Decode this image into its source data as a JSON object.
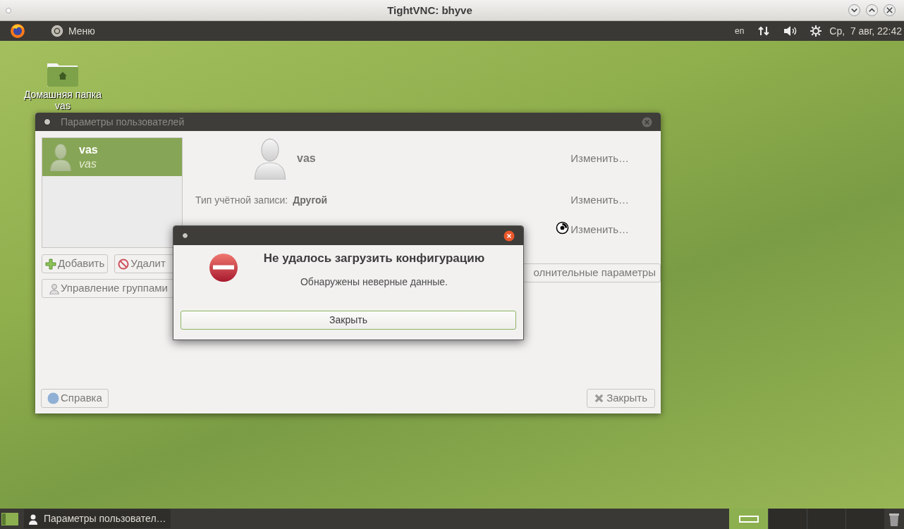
{
  "window": {
    "title": "TightVNC: bhyve"
  },
  "top_panel": {
    "menu_label": "Меню",
    "keyboard_layout": "en",
    "clock": "Ср,  7 авг, 22:42"
  },
  "desktop_icons": [
    {
      "label": "Домашняя папка vas"
    }
  ],
  "users_window": {
    "title": "Параметры пользователей",
    "users": [
      {
        "name": "vas",
        "login": "vas",
        "selected": true
      }
    ],
    "user_name": "vas",
    "rows": [
      {
        "label": "",
        "value": "",
        "action": "Изменить…"
      },
      {
        "label": "Тип учётной записи:",
        "value": "Другой",
        "action": "Изменить…"
      },
      {
        "label": "",
        "value": "",
        "action": "Изменить…"
      }
    ],
    "add_button": "Добавить",
    "remove_button": "Удалит",
    "groups_button": "Управление группами",
    "advanced_button": "олнительные параметры",
    "help_button": "Справка",
    "close_button": "Закрыть"
  },
  "error_dialog": {
    "heading": "Не удалось загрузить конфигурацию",
    "message": "Обнаружены неверные данные.",
    "button": "Закрыть"
  },
  "taskbar": {
    "tasks": [
      {
        "label": "Параметры пользовател…",
        "selected": false
      }
    ]
  }
}
